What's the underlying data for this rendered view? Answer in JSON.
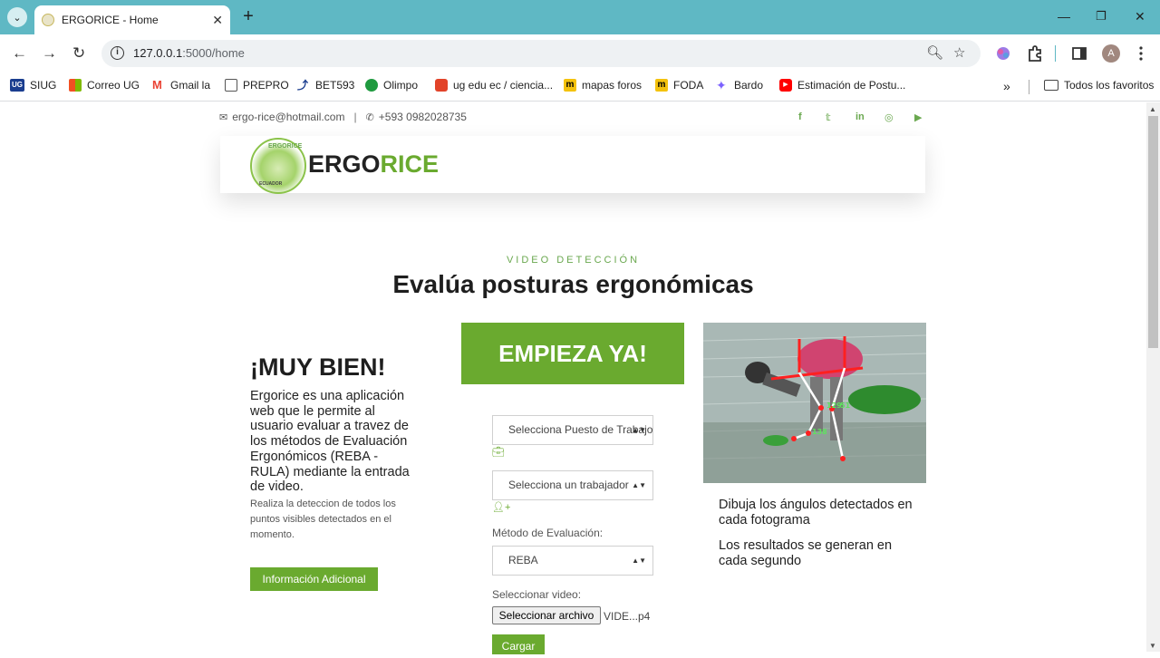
{
  "browser": {
    "tab_title": "ERGORICE - Home",
    "url_host": "127.0.0.1",
    "url_path": ":5000/home",
    "avatar_letter": "A",
    "bookmarks": [
      "SIUG",
      "Correo UG",
      "Gmail la",
      "PREPRO",
      "BET593",
      "Olimpo",
      "ug edu ec / ciencia...",
      "mapas foros",
      "FODA",
      "Bardo",
      "Estimación de Postu..."
    ],
    "all_bookmarks_label": "Todos los favoritos"
  },
  "topbar": {
    "email": "ergo-rice@hotmail.com",
    "phone": "+593 0982028735"
  },
  "brand": {
    "part1": "ERGO",
    "part2": "RICE",
    "logo_top": "ERGORICE",
    "logo_bottom": "ECUADOR"
  },
  "hero": {
    "eyebrow": "VIDEO DETECCIÓN",
    "title": "Evalúa posturas ergonómicas"
  },
  "left": {
    "heading": "¡MUY BIEN!",
    "description": "Ergorice es una aplicación web que le permite al usuario evaluar a travez de los métodos de Evaluación Ergonómicos (REBA - RULA) mediante la entrada de video.",
    "note": "Realiza la deteccion de todos los puntos visibles detectados en el momento.",
    "info_button": "Información Adicional"
  },
  "form": {
    "start_button": "EMPIEZA YA!",
    "workstation_select": "Selecciona Puesto de Trabajo",
    "worker_select": "Selecciona un trabajador",
    "method_label": "Método de Evaluación:",
    "method_value": "REBA",
    "video_label": "Seleccionar video:",
    "file_button": "Seleccionar archivo",
    "file_name": "VIDE...p4",
    "submit_button": "Cargar"
  },
  "right": {
    "line1": "Dibuja los ángulos detectados en cada fotograma",
    "line2": "Los resultados se generan en cada segundo",
    "photo_labels": [
      "129",
      "51",
      "138"
    ]
  },
  "colors": {
    "accent_green": "#6aaa2f",
    "chrome_teal": "#5fb8c4"
  }
}
